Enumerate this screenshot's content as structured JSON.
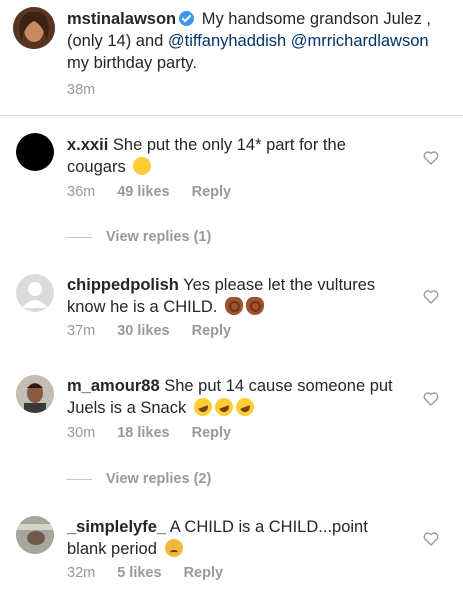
{
  "caption": {
    "username": "mstinalawson",
    "text_before": " My handsome grandson Julez , (only 14) and ",
    "mention1": "@tiffanyhaddish",
    "mention2": "@mrrichardlawson",
    "text_after": "  my birthday party.",
    "time": "38m"
  },
  "comments": [
    {
      "username": "x.xxii",
      "text": " She put the only 14* part for the cougars",
      "emoji": [
        "grinning-sweat-emoji"
      ],
      "time": "36m",
      "likes": "49 likes",
      "reply": "Reply"
    },
    {
      "username": "chippedpolish",
      "text": " Yes please let the vultures know he is a CHILD.",
      "emoji": [
        "ok-hand-emoji",
        "ok-hand-emoji"
      ],
      "time": "37m",
      "likes": "30 likes",
      "reply": "Reply"
    },
    {
      "username": "m_amour88",
      "text": " She put 14 cause someone put Juels is a Snack",
      "emoji": [
        "rofl-emoji",
        "rofl-emoji",
        "rofl-emoji"
      ],
      "time": "30m",
      "likes": "18 likes",
      "reply": "Reply"
    },
    {
      "username": "_simplelyfe_",
      "text": " A CHILD is a CHILD...point blank period",
      "emoji": [
        "angry-face-emoji"
      ],
      "time": "32m",
      "likes": "5 likes",
      "reply": "Reply"
    }
  ],
  "view_replies": [
    "View replies (1)",
    "View replies (2)"
  ],
  "colors": {
    "verified": "#3897f0",
    "mention": "#003569",
    "meta": "#999999",
    "divider": "#dbdbdb"
  },
  "icons": {
    "verified": "verified-badge-icon",
    "like": "heart-outline-icon"
  }
}
